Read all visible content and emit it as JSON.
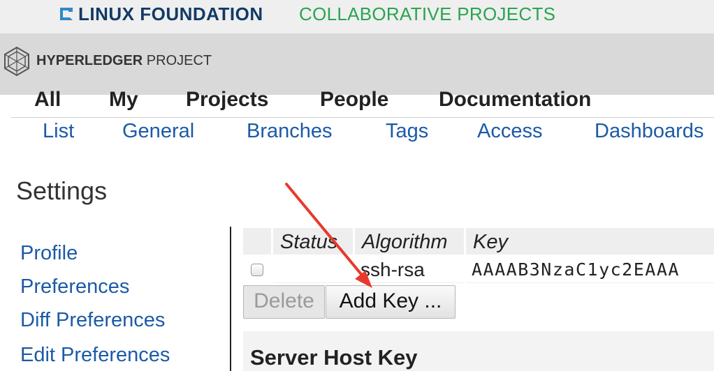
{
  "banner": {
    "title": "LINUX FOUNDATION",
    "subtitle": "COLLABORATIVE PROJECTS"
  },
  "header": {
    "brand_bold": "HYPERLEDGER",
    "brand_light": " PROJECT"
  },
  "top_menu": {
    "items": [
      "All",
      "My",
      "Projects",
      "People",
      "Documentation"
    ]
  },
  "sub_menu": {
    "items": [
      "List",
      "General",
      "Branches",
      "Tags",
      "Access",
      "Dashboards"
    ]
  },
  "page": {
    "title": "Settings"
  },
  "settings_nav": {
    "items": [
      "Profile",
      "Preferences",
      "Diff Preferences",
      "Edit Preferences"
    ]
  },
  "keys_table": {
    "headers": [
      "Status",
      "Algorithm",
      "Key"
    ],
    "rows": [
      {
        "checked": false,
        "status": "",
        "algorithm": "ssh-rsa",
        "key": "AAAAB3NzaC1yc2EAAA"
      }
    ]
  },
  "buttons": {
    "delete": "Delete",
    "add_key": "Add Key ..."
  },
  "server_host_key": {
    "title": "Server Host Key"
  },
  "colors": {
    "link": "#1c5aa6",
    "lf_navy": "#123a66",
    "lf_green": "#2aa44f",
    "annotation_arrow": "#e8392b"
  }
}
